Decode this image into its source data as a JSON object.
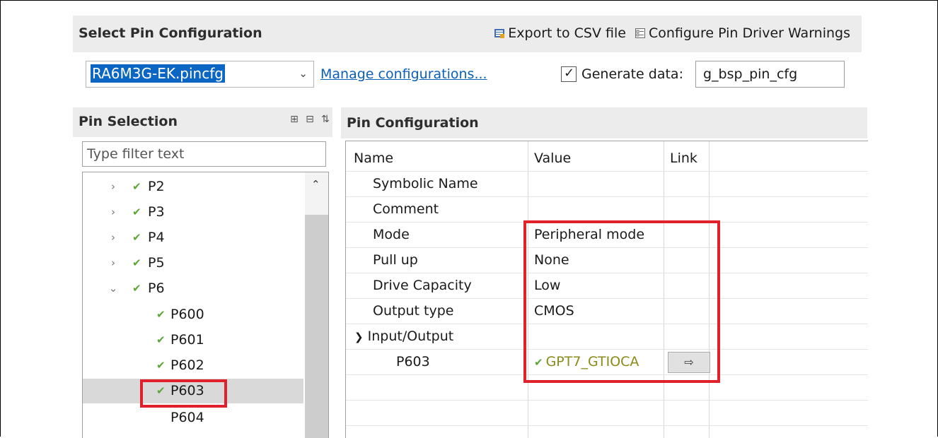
{
  "header": {
    "title": "Select Pin Configuration",
    "export_label": "Export to CSV file",
    "warnings_label": "Configure Pin Driver Warnings"
  },
  "config": {
    "selected": "RA6M3G-EK.pincfg",
    "manage_link": "Manage configurations...",
    "generate_label": "Generate data:",
    "generate_checked": true,
    "generate_value": "g_bsp_pin_cfg"
  },
  "pin_selection": {
    "title": "Pin Selection",
    "filter_placeholder": "Type filter text",
    "items": [
      {
        "label": "P2",
        "expander": "›",
        "checked": true
      },
      {
        "label": "P3",
        "expander": "›",
        "checked": true
      },
      {
        "label": "P4",
        "expander": "›",
        "checked": true
      },
      {
        "label": "P5",
        "expander": "›",
        "checked": true
      },
      {
        "label": "P6",
        "expander": "⌄",
        "checked": true
      },
      {
        "label": "P600",
        "checked": true
      },
      {
        "label": "P601",
        "checked": true
      },
      {
        "label": "P602",
        "checked": true
      },
      {
        "label": "P603",
        "checked": true,
        "selected": true
      },
      {
        "label": "P604",
        "checked": false
      }
    ]
  },
  "pin_config": {
    "title": "Pin Configuration",
    "columns": [
      "Name",
      "Value",
      "Link"
    ],
    "rows": [
      {
        "name": "Symbolic Name",
        "value": ""
      },
      {
        "name": "Comment",
        "value": ""
      },
      {
        "name": "Mode",
        "value": "Peripheral mode"
      },
      {
        "name": "Pull up",
        "value": "None"
      },
      {
        "name": "Drive Capacity",
        "value": "Low"
      },
      {
        "name": "Output type",
        "value": "CMOS"
      },
      {
        "name": "Input/Output",
        "value": ""
      },
      {
        "name": "P603",
        "value": "GPT7_GTIOCA"
      }
    ],
    "link_button_symbol": "⇨"
  },
  "colors": {
    "highlight": "#e0202b",
    "selection": "#0b66c3",
    "check": "#5aa832"
  }
}
